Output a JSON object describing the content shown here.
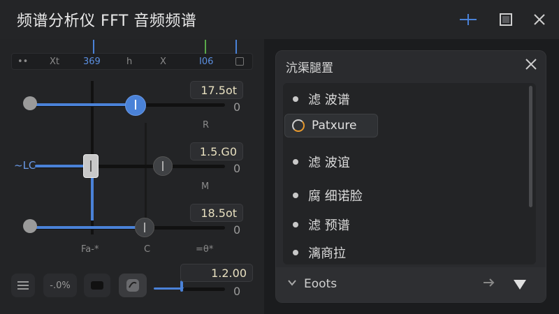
{
  "window": {
    "title": "频谱分析仪 FFT 音频频谱"
  },
  "ruler": {
    "labels": [
      "••",
      "Xt",
      "369",
      "h",
      "X",
      "I06"
    ]
  },
  "sliders": [
    {
      "value": "17.5ot",
      "zero": "0",
      "axis": "R"
    },
    {
      "value": "1.5.G0",
      "zero": "0",
      "axis": "M",
      "side_label": "~LC"
    },
    {
      "value": "18.5ot",
      "zero": "0"
    }
  ],
  "bottom_axis": [
    "Fa-*",
    "C",
    "=θ*"
  ],
  "toolbar": {
    "percent_label": "-.0%",
    "value": "1.2.00",
    "zero": "0"
  },
  "panel": {
    "title": "沆渠腿置",
    "items": [
      {
        "label": "滤 波谱"
      },
      {
        "label": "Patxure",
        "selected": true
      },
      {
        "label": "滤 波谊"
      },
      {
        "label": "腐 细诺脸"
      },
      {
        "label": "滤 预谱"
      },
      {
        "label": "漓商拉"
      }
    ],
    "footer_label": "Eoots"
  },
  "colors": {
    "accent": "#4a82d8",
    "spinner": "#e89a2e"
  }
}
